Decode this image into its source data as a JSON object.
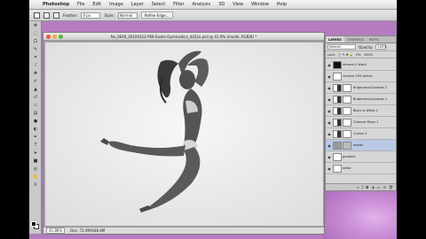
{
  "menubar": {
    "app_name": "Photoshop",
    "items": [
      "File",
      "Edit",
      "Image",
      "Layer",
      "Select",
      "Filter",
      "Analysis",
      "3D",
      "View",
      "Window",
      "Help"
    ]
  },
  "options": {
    "feather_label": "Feather:",
    "feather_value": "0 px",
    "style_label": "Style:",
    "style_value": "Normal",
    "refine_label": "Refine Edge..."
  },
  "document": {
    "title": "Nx_0649_20100322-PKK-Sasha-Gymnastics_4432x.psd @ 41.9% (model, RGB/8) *",
    "zoom": "41.86%",
    "doc_info": "Doc: 72.0M/648.4M"
  },
  "layers_panel": {
    "tabs": [
      "LAYERS",
      "CHANNELS",
      "PATHS"
    ],
    "blend_mode": "Normal",
    "opacity_label": "Opacity:",
    "opacity_value": "100%",
    "lock_label": "Lock:",
    "fill_label": "Fill:",
    "fill_value": "100%",
    "layers": [
      {
        "name": "remove if black",
        "thumb": "black",
        "mask": false,
        "selected": false
      },
      {
        "name": "remove 255 whites",
        "thumb": "white",
        "mask": false,
        "selected": false
      },
      {
        "name": "Brightness/Contrast 2",
        "thumb": "adj",
        "mask": true,
        "selected": false
      },
      {
        "name": "Brightness/Contrast 1",
        "thumb": "adj",
        "mask": true,
        "selected": false
      },
      {
        "name": "Black & White 1",
        "thumb": "adj",
        "mask": true,
        "selected": false
      },
      {
        "name": "Channel Mixer 1",
        "thumb": "adj",
        "mask": true,
        "selected": false
      },
      {
        "name": "Curves 2",
        "thumb": "adj",
        "mask": true,
        "selected": false
      },
      {
        "name": "model",
        "thumb": "grey",
        "mask": false,
        "selected": true
      },
      {
        "name": "gradient",
        "thumb": "white",
        "mask": false,
        "selected": false
      },
      {
        "name": "white",
        "thumb": "white",
        "mask": false,
        "selected": false
      }
    ]
  },
  "colors": {
    "desktop": "#b57cc0",
    "canvas_bg": "#efefef",
    "selected_layer": "#b9c9e6"
  }
}
